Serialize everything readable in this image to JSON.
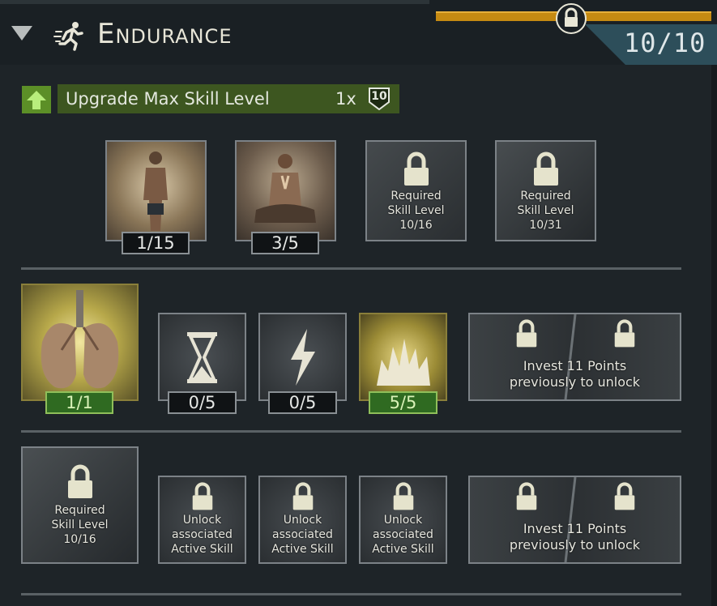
{
  "panel": {
    "title": "Endurance",
    "level": "10/10"
  },
  "upgrade": {
    "label": "Upgrade Max Skill Level",
    "multiplier": "1x",
    "badge": "10"
  },
  "row1": {
    "tiles": [
      {
        "counter": "1/15"
      },
      {
        "counter": "3/5"
      },
      {
        "locked_line1": "Required",
        "locked_line2": "Skill Level",
        "locked_line3": "10/16"
      },
      {
        "locked_line1": "Required",
        "locked_line2": "Skill Level",
        "locked_line3": "10/31"
      }
    ]
  },
  "row2": {
    "tiles": [
      {
        "counter": "1/1"
      },
      {
        "counter": "0/5"
      },
      {
        "counter": "0/5"
      },
      {
        "counter": "5/5"
      }
    ],
    "invest_line1": "Invest 11 Points",
    "invest_line2": "previously to unlock"
  },
  "row3": {
    "tiles": [
      {
        "locked_line1": "Required",
        "locked_line2": "Skill Level",
        "locked_line3": "10/16"
      },
      {
        "locked_line1": "Unlock",
        "locked_line2": "associated",
        "locked_line3": "Active Skill"
      },
      {
        "locked_line1": "Unlock",
        "locked_line2": "associated",
        "locked_line3": "Active Skill"
      },
      {
        "locked_line1": "Unlock",
        "locked_line2": "associated",
        "locked_line3": "Active Skill"
      }
    ],
    "invest_line1": "Invest 11 Points",
    "invest_line2": "previously to unlock"
  },
  "colors": {
    "accent_orange": "#c58a12",
    "counter_green": "#2f6a21",
    "upgrade_green": "#3d5620"
  }
}
